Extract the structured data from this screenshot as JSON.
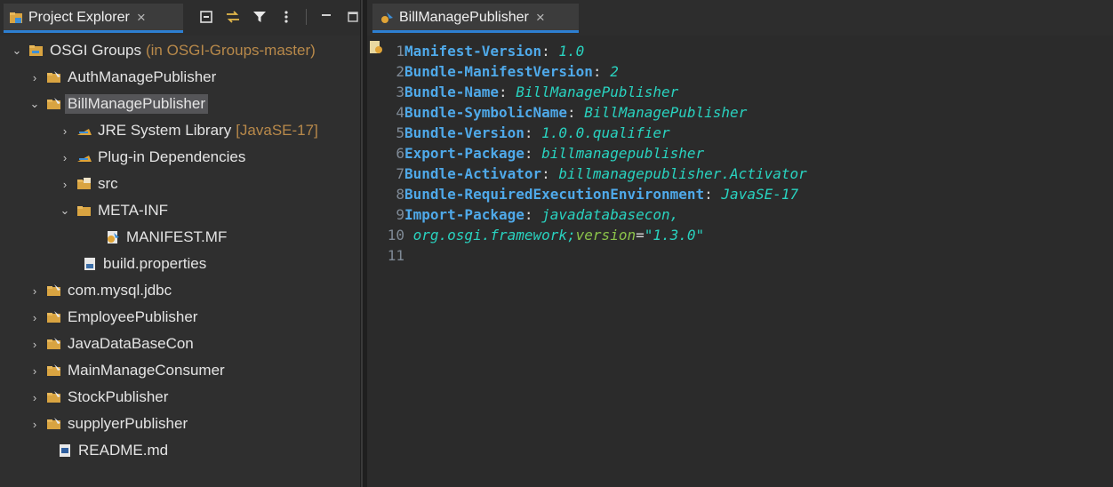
{
  "explorer": {
    "tab_label": "Project Explorer",
    "tab_close": "×",
    "tree": [
      {
        "label": "OSGI Groups",
        "decoration": "(in OSGI-Groups-master)",
        "expanded": true,
        "icon": "project-folder-icon"
      },
      {
        "label": "AuthManagePublisher",
        "expanded": false,
        "icon": "plugin-project-icon"
      },
      {
        "label": "BillManagePublisher",
        "expanded": true,
        "icon": "plugin-project-icon",
        "selected": true
      },
      {
        "label": "JRE System Library",
        "decoration": "[JavaSE-17]",
        "expanded": false,
        "icon": "library-icon"
      },
      {
        "label": "Plug-in Dependencies",
        "expanded": false,
        "icon": "library-icon"
      },
      {
        "label": "src",
        "expanded": false,
        "icon": "source-folder-icon"
      },
      {
        "label": "META-INF",
        "expanded": true,
        "icon": "folder-icon"
      },
      {
        "label": "MANIFEST.MF",
        "icon": "manifest-file-icon"
      },
      {
        "label": "build.properties",
        "icon": "properties-file-icon"
      },
      {
        "label": "com.mysql.jdbc",
        "expanded": false,
        "icon": "plugin-project-icon"
      },
      {
        "label": "EmployeePublisher",
        "expanded": false,
        "icon": "plugin-project-icon"
      },
      {
        "label": "JavaDataBaseCon",
        "expanded": false,
        "icon": "plugin-project-icon"
      },
      {
        "label": "MainManageConsumer",
        "expanded": false,
        "icon": "plugin-project-icon"
      },
      {
        "label": "StockPublisher",
        "expanded": false,
        "icon": "plugin-project-icon"
      },
      {
        "label": "supplyerPublisher",
        "expanded": false,
        "icon": "plugin-project-icon"
      },
      {
        "label": "README.md",
        "icon": "markdown-file-icon"
      }
    ]
  },
  "editor": {
    "tab_label": "BillManagePublisher",
    "tab_close": "×",
    "lines": [
      {
        "n": "1",
        "key": "Manifest-Version",
        "value": "1.0"
      },
      {
        "n": "2",
        "key": "Bundle-ManifestVersion",
        "value": "2"
      },
      {
        "n": "3",
        "key": "Bundle-Name",
        "value": "BillManagePublisher"
      },
      {
        "n": "4",
        "key": "Bundle-SymbolicName",
        "value": "BillManagePublisher"
      },
      {
        "n": "5",
        "key": "Bundle-Version",
        "value": "1.0.0.qualifier"
      },
      {
        "n": "6",
        "key": "Export-Package",
        "value": "billmanagepublisher"
      },
      {
        "n": "7",
        "key": "Bundle-Activator",
        "value": "billmanagepublisher.Activator"
      },
      {
        "n": "8",
        "key": "Bundle-RequiredExecutionEnvironment",
        "value": "JavaSE-17"
      },
      {
        "n": "9",
        "key": "Import-Package",
        "value": "javadatabasecon,"
      },
      {
        "n": "10",
        "continuation": " org.osgi.framework;",
        "attr": "version",
        "eq": "=",
        "str": "\"1.3.0\""
      },
      {
        "n": "11"
      }
    ]
  },
  "colors": {
    "accent": "#2d7fd2",
    "key": "#4fa9e9",
    "value": "#29d3c0",
    "attr": "#8bc34a"
  }
}
